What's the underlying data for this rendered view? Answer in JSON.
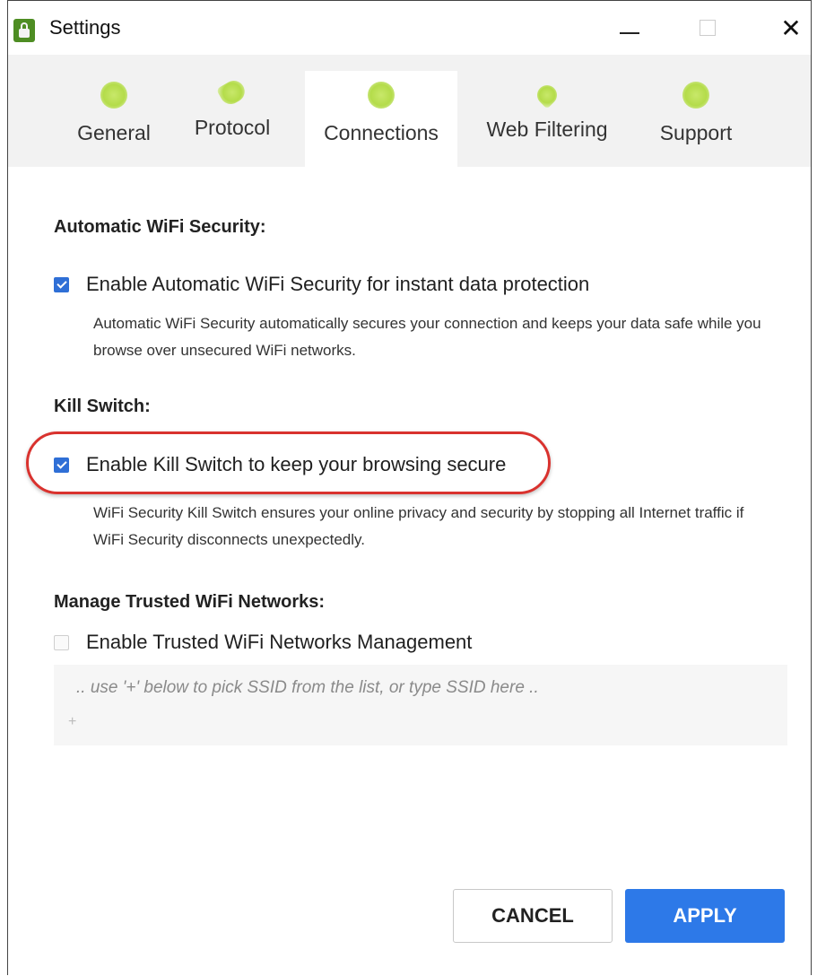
{
  "window": {
    "title": "Settings"
  },
  "tabs": [
    {
      "label": "General",
      "icon": "gear-icon"
    },
    {
      "label": "Protocol",
      "icon": "key-icon"
    },
    {
      "label": "Connections",
      "icon": "connections-icon",
      "active": true
    },
    {
      "label": "Web Filtering",
      "icon": "web-filtering-icon"
    },
    {
      "label": "Support",
      "icon": "support-icon"
    }
  ],
  "sections": {
    "wifi_security": {
      "heading": "Automatic WiFi Security:",
      "checkbox_label": "Enable Automatic WiFi Security for instant data protection",
      "checked": true,
      "description": "Automatic WiFi Security automatically secures your connection and keeps your data safe while you browse over unsecured WiFi networks."
    },
    "kill_switch": {
      "heading": "Kill Switch:",
      "checkbox_label": "Enable Kill Switch to keep your browsing secure",
      "checked": true,
      "description": "WiFi Security Kill Switch ensures your online privacy and security by stopping all Internet traffic if WiFi Security disconnects unexpectedly."
    },
    "trusted_networks": {
      "heading": "Manage Trusted WiFi Networks:",
      "checkbox_label": "Enable Trusted WiFi Networks Management",
      "checked": false,
      "placeholder": ".. use '+' below to pick SSID from the list, or type SSID here ..",
      "add_symbol": "+"
    }
  },
  "buttons": {
    "cancel": "CANCEL",
    "apply": "APPLY"
  },
  "colors": {
    "accent_blue": "#2d79e8",
    "checkbox_blue": "#2f6fd6",
    "highlight_red": "#d9322e",
    "brand_green": "#4e8d23",
    "tab_icon_green": "#b4dc4a"
  }
}
